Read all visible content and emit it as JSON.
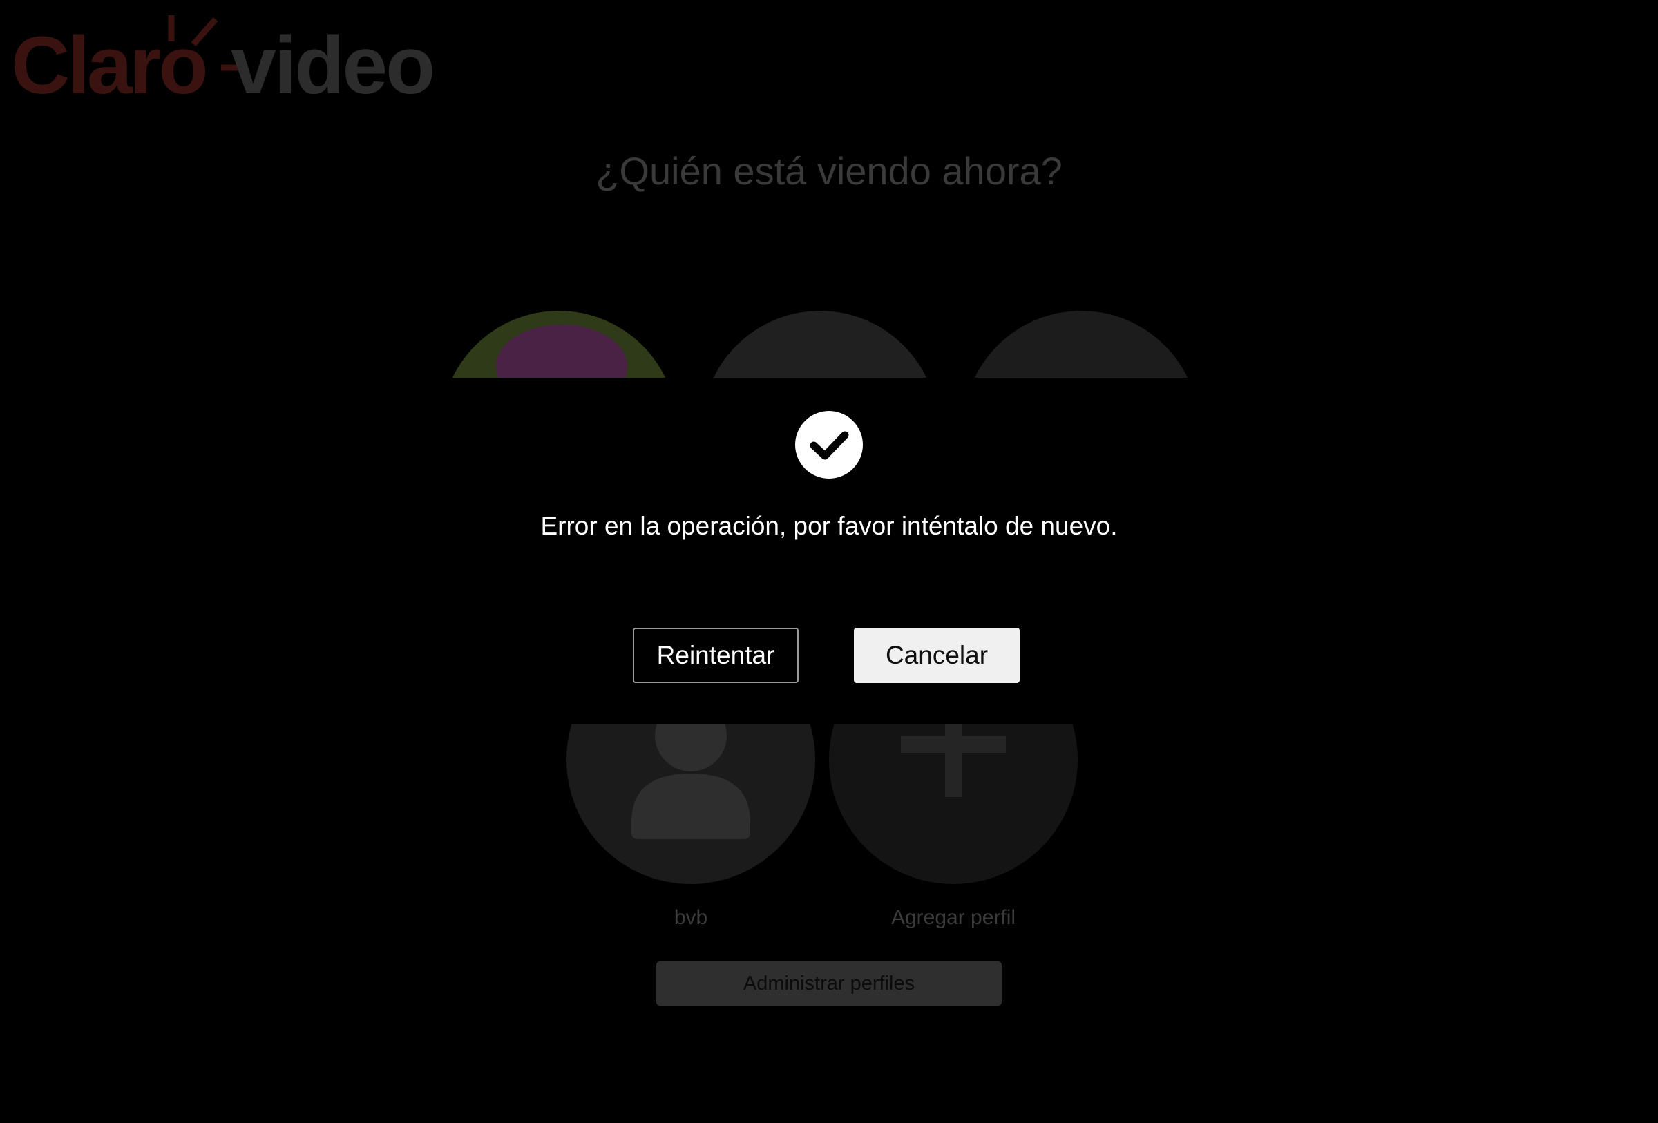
{
  "brand": {
    "logo_part1": "Claro",
    "logo_part2": "video",
    "accent_color": "#3a1210"
  },
  "page": {
    "title": "¿Quién está viendo ahora?"
  },
  "profiles": [
    {
      "name": "bvb",
      "icon": "person-icon"
    },
    {
      "name": "Agregar perfil",
      "icon": "plus-icon"
    }
  ],
  "manage_button": "Administrar perfiles",
  "modal": {
    "icon": "check-circle-icon",
    "message": "Error en la operación, por favor inténtalo de nuevo.",
    "retry_label": "Reintentar",
    "cancel_label": "Cancelar"
  }
}
